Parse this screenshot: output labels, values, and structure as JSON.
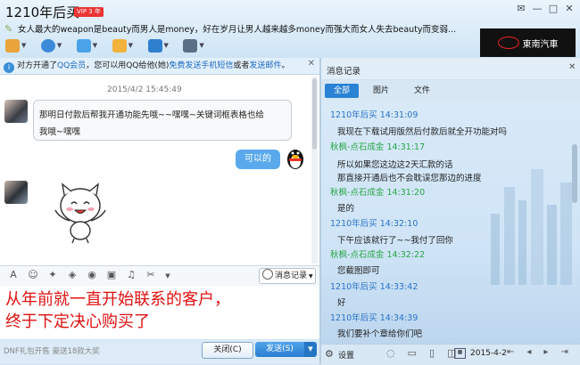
{
  "window": {
    "title": "1210年后买",
    "vip_badge": "VIP 3 年",
    "signature": "女人最大的weapon是beauty而男人是money，好在岁月让男人越来越多money而强大而女人失去beauty而变弱...",
    "ad_text": "東南汽車"
  },
  "toolbar": {
    "icons": [
      "microphone-icon",
      "camera-icon",
      "screen-share-icon",
      "folder-icon",
      "remote-desktop-icon",
      "app-grid-icon"
    ]
  },
  "notice": {
    "prefix": "对方开通了",
    "link1": "QQ会员",
    "middle": "，您可以用QQ给他(她)",
    "link2": "免费发送手机短信",
    "connector": "或者",
    "link3": "发送邮件",
    "suffix": "。"
  },
  "chat": {
    "timestamp": "2015/4/2  15:45:49",
    "incoming_lines": [
      "那明日付款后帮我开通功能先哦~~嘿嘿~关键词框表格也给",
      "我哦~嘿嘿"
    ],
    "outgoing": "可以的"
  },
  "input": {
    "history_button": "消息记录",
    "caption_line1": "从年前就一直开始联系的客户，",
    "caption_line2": "终于下定决心购买了",
    "footer_note": "DNF礼包开售 豪送18款大奖",
    "close_label": "关闭(C)",
    "send_label": "发送(S)"
  },
  "history": {
    "title": "消息记录",
    "tabs": [
      "全部",
      "图片",
      "文件"
    ],
    "entries": [
      {
        "type": "hdr",
        "text": "1210年后买  14:31:09"
      },
      {
        "type": "txt",
        "text": "我现在下载试用版然后付款后就全开功能对吗"
      },
      {
        "type": "hdr2",
        "text": "秋枫-点石成金  14:31:17"
      },
      {
        "type": "txt",
        "text": "所以如果您这边这2天汇款的话"
      },
      {
        "type": "txt",
        "text": "那直接开通后也不会耽误您那边的进度"
      },
      {
        "type": "hdr2",
        "text": "秋枫-点石成金  14:31:20"
      },
      {
        "type": "txt",
        "text": "是的"
      },
      {
        "type": "hdr",
        "text": "1210年后买  14:32:10"
      },
      {
        "type": "txt",
        "text": "下午应该就行了~~我付了回你"
      },
      {
        "type": "hdr2",
        "text": "秋枫-点石成金  14:32:22"
      },
      {
        "type": "txt",
        "text": "您截图即可"
      },
      {
        "type": "hdr",
        "text": "1210年后买  14:33:42"
      },
      {
        "type": "txt",
        "text": "好"
      },
      {
        "type": "hdr",
        "text": "1210年后买  14:34:39"
      },
      {
        "type": "txt",
        "text": "我们要补个章给你们吧"
      }
    ],
    "settings_label": "设置",
    "date_value": "2015-4-2"
  }
}
